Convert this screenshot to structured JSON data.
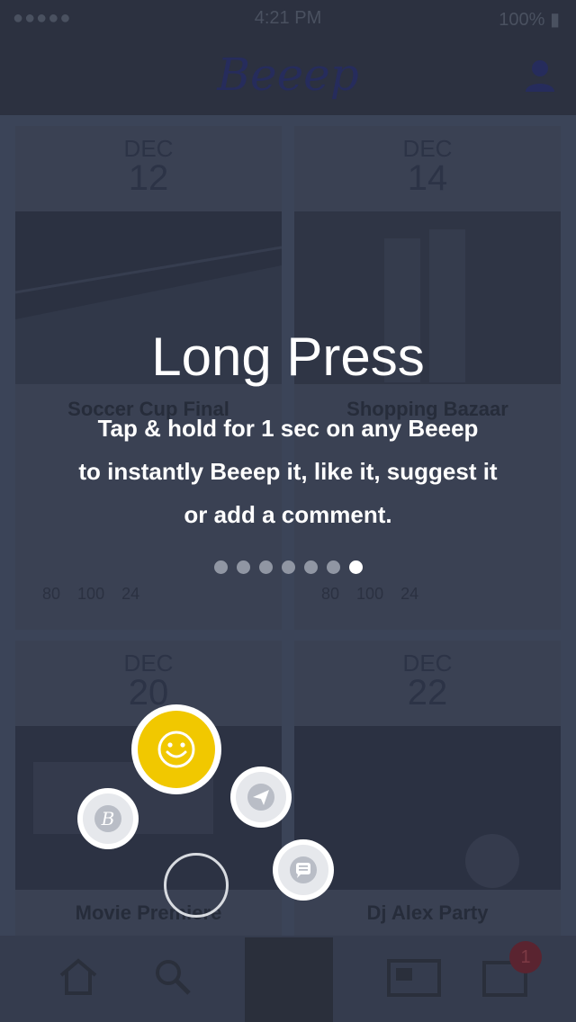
{
  "status": {
    "carrier": "●●●●● ",
    "time": "4:21 PM",
    "battery": "100% ▮"
  },
  "header": {
    "logo": "Beeep"
  },
  "cards": [
    {
      "month": "DEC",
      "day": "12",
      "title": "Soccer Cup Final",
      "stats": [
        "80",
        "100",
        "24"
      ]
    },
    {
      "month": "DEC",
      "day": "14",
      "title": "Shopping Bazaar",
      "stats": [
        "80",
        "100",
        "24"
      ]
    },
    {
      "month": "DEC",
      "day": "20",
      "title": "Movie Premiere"
    },
    {
      "month": "DEC",
      "day": "22",
      "title": "Dj Alex Party"
    }
  ],
  "tutorial": {
    "title": "Long Press",
    "line1": "Tap & hold for 1 sec on any Beeep",
    "line2": "to instantly Beeep it, like it, suggest it",
    "line3": "or add a comment.",
    "page_index": 6,
    "page_count": 7
  },
  "radial_menu": {
    "items": [
      "like-smiley",
      "beeep-it",
      "suggest-send",
      "comment"
    ]
  },
  "tabbar": {
    "badge_count": "1"
  },
  "colors": {
    "accent_yellow": "#f1c800",
    "overlay_bg": "#3b4458"
  }
}
